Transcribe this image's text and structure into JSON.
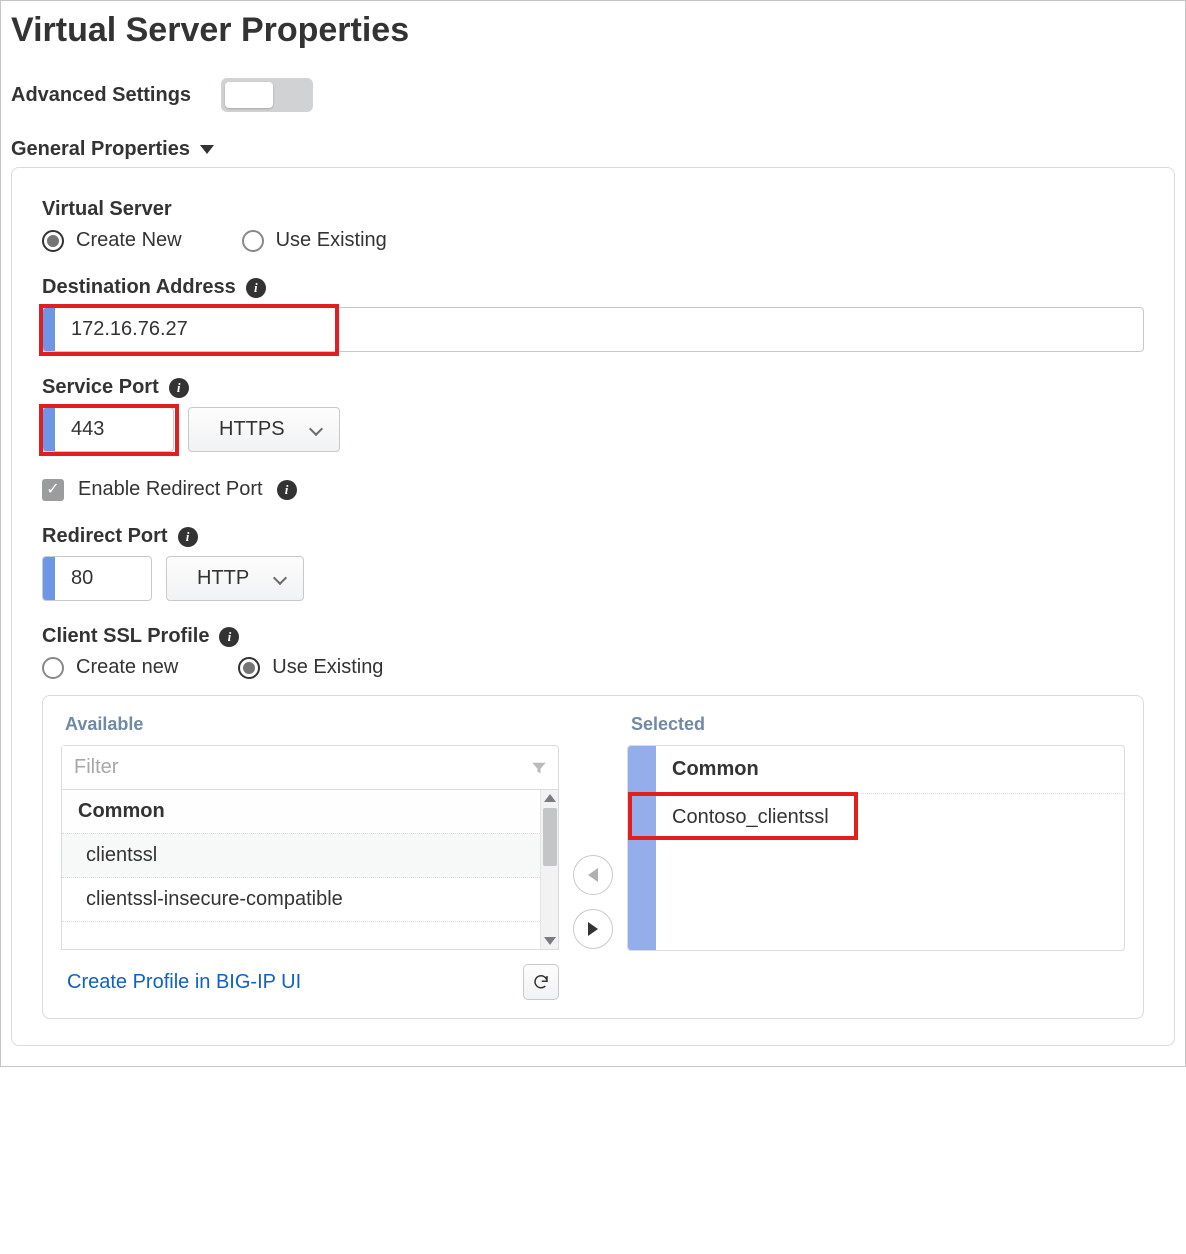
{
  "page": {
    "title": "Virtual Server Properties"
  },
  "adv": {
    "label": "Advanced Settings",
    "on": false
  },
  "section": {
    "general": "General Properties"
  },
  "vs": {
    "label": "Virtual Server",
    "create_new": "Create New",
    "use_existing": "Use Existing",
    "selected": "create_new"
  },
  "dest": {
    "label": "Destination Address",
    "value": "172.16.76.27",
    "highlight": true
  },
  "port": {
    "label": "Service Port",
    "value": "443",
    "protocol": "HTTPS",
    "highlight": true
  },
  "redir_enable": {
    "label": "Enable Redirect Port",
    "checked": true
  },
  "redir": {
    "label": "Redirect Port",
    "value": "80",
    "protocol": "HTTP"
  },
  "ssl": {
    "label": "Client SSL Profile",
    "create_new": "Create new",
    "use_existing": "Use Existing",
    "selected": "use_existing",
    "available_title": "Available",
    "selected_title": "Selected",
    "filter_placeholder": "Filter",
    "group": "Common",
    "available": [
      "clientssl",
      "clientssl-insecure-compatible"
    ],
    "selected_item": "Contoso_clientssl",
    "selected_highlight": true,
    "create_link": "Create Profile in BIG-IP UI"
  }
}
